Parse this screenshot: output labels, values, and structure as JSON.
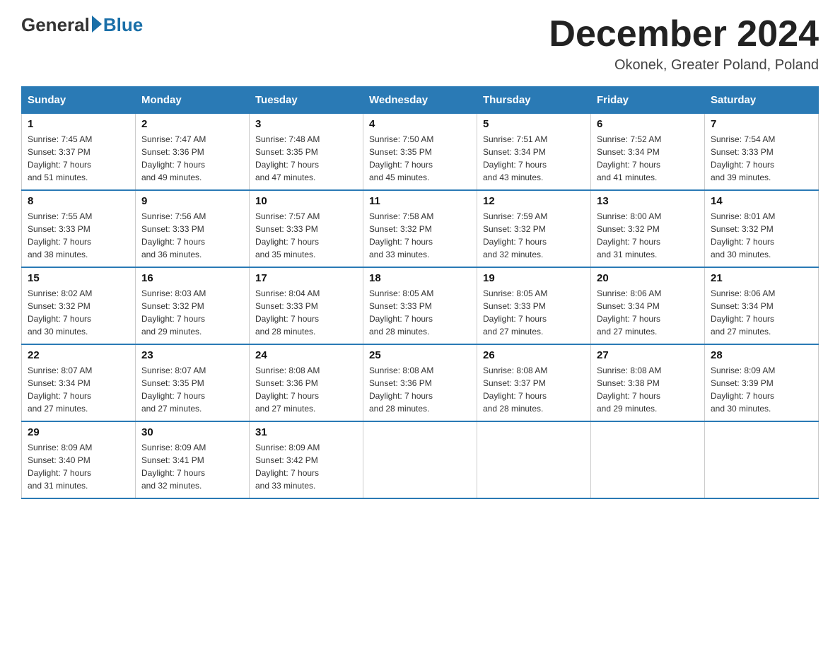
{
  "header": {
    "logo_general": "General",
    "logo_blue": "Blue",
    "month_title": "December 2024",
    "location": "Okonek, Greater Poland, Poland"
  },
  "days_of_week": [
    "Sunday",
    "Monday",
    "Tuesday",
    "Wednesday",
    "Thursday",
    "Friday",
    "Saturday"
  ],
  "weeks": [
    [
      {
        "num": "1",
        "info": "Sunrise: 7:45 AM\nSunset: 3:37 PM\nDaylight: 7 hours\nand 51 minutes."
      },
      {
        "num": "2",
        "info": "Sunrise: 7:47 AM\nSunset: 3:36 PM\nDaylight: 7 hours\nand 49 minutes."
      },
      {
        "num": "3",
        "info": "Sunrise: 7:48 AM\nSunset: 3:35 PM\nDaylight: 7 hours\nand 47 minutes."
      },
      {
        "num": "4",
        "info": "Sunrise: 7:50 AM\nSunset: 3:35 PM\nDaylight: 7 hours\nand 45 minutes."
      },
      {
        "num": "5",
        "info": "Sunrise: 7:51 AM\nSunset: 3:34 PM\nDaylight: 7 hours\nand 43 minutes."
      },
      {
        "num": "6",
        "info": "Sunrise: 7:52 AM\nSunset: 3:34 PM\nDaylight: 7 hours\nand 41 minutes."
      },
      {
        "num": "7",
        "info": "Sunrise: 7:54 AM\nSunset: 3:33 PM\nDaylight: 7 hours\nand 39 minutes."
      }
    ],
    [
      {
        "num": "8",
        "info": "Sunrise: 7:55 AM\nSunset: 3:33 PM\nDaylight: 7 hours\nand 38 minutes."
      },
      {
        "num": "9",
        "info": "Sunrise: 7:56 AM\nSunset: 3:33 PM\nDaylight: 7 hours\nand 36 minutes."
      },
      {
        "num": "10",
        "info": "Sunrise: 7:57 AM\nSunset: 3:33 PM\nDaylight: 7 hours\nand 35 minutes."
      },
      {
        "num": "11",
        "info": "Sunrise: 7:58 AM\nSunset: 3:32 PM\nDaylight: 7 hours\nand 33 minutes."
      },
      {
        "num": "12",
        "info": "Sunrise: 7:59 AM\nSunset: 3:32 PM\nDaylight: 7 hours\nand 32 minutes."
      },
      {
        "num": "13",
        "info": "Sunrise: 8:00 AM\nSunset: 3:32 PM\nDaylight: 7 hours\nand 31 minutes."
      },
      {
        "num": "14",
        "info": "Sunrise: 8:01 AM\nSunset: 3:32 PM\nDaylight: 7 hours\nand 30 minutes."
      }
    ],
    [
      {
        "num": "15",
        "info": "Sunrise: 8:02 AM\nSunset: 3:32 PM\nDaylight: 7 hours\nand 30 minutes."
      },
      {
        "num": "16",
        "info": "Sunrise: 8:03 AM\nSunset: 3:32 PM\nDaylight: 7 hours\nand 29 minutes."
      },
      {
        "num": "17",
        "info": "Sunrise: 8:04 AM\nSunset: 3:33 PM\nDaylight: 7 hours\nand 28 minutes."
      },
      {
        "num": "18",
        "info": "Sunrise: 8:05 AM\nSunset: 3:33 PM\nDaylight: 7 hours\nand 28 minutes."
      },
      {
        "num": "19",
        "info": "Sunrise: 8:05 AM\nSunset: 3:33 PM\nDaylight: 7 hours\nand 27 minutes."
      },
      {
        "num": "20",
        "info": "Sunrise: 8:06 AM\nSunset: 3:34 PM\nDaylight: 7 hours\nand 27 minutes."
      },
      {
        "num": "21",
        "info": "Sunrise: 8:06 AM\nSunset: 3:34 PM\nDaylight: 7 hours\nand 27 minutes."
      }
    ],
    [
      {
        "num": "22",
        "info": "Sunrise: 8:07 AM\nSunset: 3:34 PM\nDaylight: 7 hours\nand 27 minutes."
      },
      {
        "num": "23",
        "info": "Sunrise: 8:07 AM\nSunset: 3:35 PM\nDaylight: 7 hours\nand 27 minutes."
      },
      {
        "num": "24",
        "info": "Sunrise: 8:08 AM\nSunset: 3:36 PM\nDaylight: 7 hours\nand 27 minutes."
      },
      {
        "num": "25",
        "info": "Sunrise: 8:08 AM\nSunset: 3:36 PM\nDaylight: 7 hours\nand 28 minutes."
      },
      {
        "num": "26",
        "info": "Sunrise: 8:08 AM\nSunset: 3:37 PM\nDaylight: 7 hours\nand 28 minutes."
      },
      {
        "num": "27",
        "info": "Sunrise: 8:08 AM\nSunset: 3:38 PM\nDaylight: 7 hours\nand 29 minutes."
      },
      {
        "num": "28",
        "info": "Sunrise: 8:09 AM\nSunset: 3:39 PM\nDaylight: 7 hours\nand 30 minutes."
      }
    ],
    [
      {
        "num": "29",
        "info": "Sunrise: 8:09 AM\nSunset: 3:40 PM\nDaylight: 7 hours\nand 31 minutes."
      },
      {
        "num": "30",
        "info": "Sunrise: 8:09 AM\nSunset: 3:41 PM\nDaylight: 7 hours\nand 32 minutes."
      },
      {
        "num": "31",
        "info": "Sunrise: 8:09 AM\nSunset: 3:42 PM\nDaylight: 7 hours\nand 33 minutes."
      },
      null,
      null,
      null,
      null
    ]
  ]
}
